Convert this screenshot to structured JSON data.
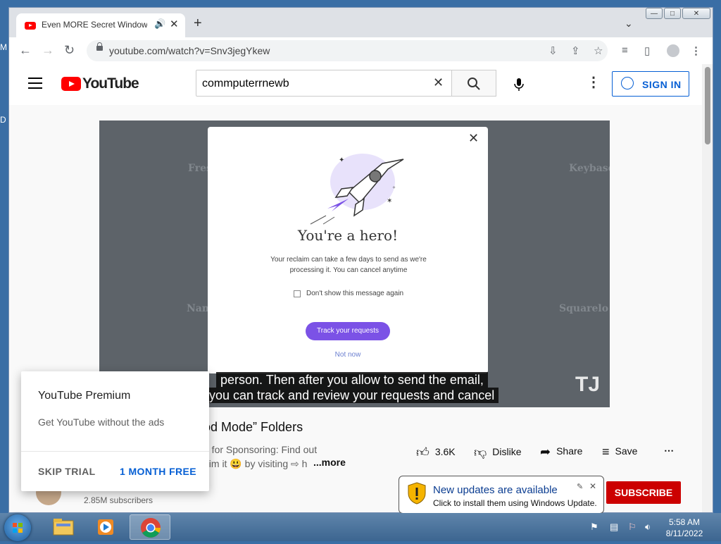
{
  "desktop": {
    "label_top": "M",
    "label_mid": "D"
  },
  "browser": {
    "tab_title": "Even MORE Secret Windows",
    "tab_audio_icon": "speaker-icon",
    "url": "youtube.com/watch?v=Snv3jegYkew",
    "window_buttons": [
      "—",
      "□",
      "✕"
    ]
  },
  "youtube": {
    "logo_text": "YouTube",
    "search_value": "commputerrnewb",
    "signin_label": "SIGN IN"
  },
  "video": {
    "bg_cards": [
      "Fres",
      "Keybase",
      "Nam",
      "Squarelo"
    ],
    "modal": {
      "title": "You're a hero!",
      "body": "Your reclaim can take a few days to send as we're processing it. You can cancel anytime",
      "checkbox_label": "Don't show this message again",
      "primary_button": "Track your requests",
      "secondary_link": "Not now"
    },
    "captions": [
      "person. Then after you allow to send the email,",
      "you can track and review your requests and cancel"
    ],
    "watermark": "TJ"
  },
  "info": {
    "title_visible": "od Mode” Folders",
    "desc_line1": "e for Sponsoring: Find out",
    "desc_line2": "aim it 😃 by visiting ⇨ h",
    "more": "...more",
    "likes": "3.6K",
    "dislike": "Dislike",
    "share": "Share",
    "save": "Save",
    "subscribers": "2.85M subscribers",
    "subscribe": "SUBSCRIBE"
  },
  "premium": {
    "title": "YouTube Premium",
    "subtitle": "Get YouTube without the ads",
    "skip": "SKIP TRIAL",
    "month": "1 MONTH FREE"
  },
  "balloon": {
    "title": "New updates are available",
    "text": "Click to install them using Windows Update."
  },
  "taskbar": {
    "time": "5:58 AM",
    "date": "8/11/2022"
  }
}
